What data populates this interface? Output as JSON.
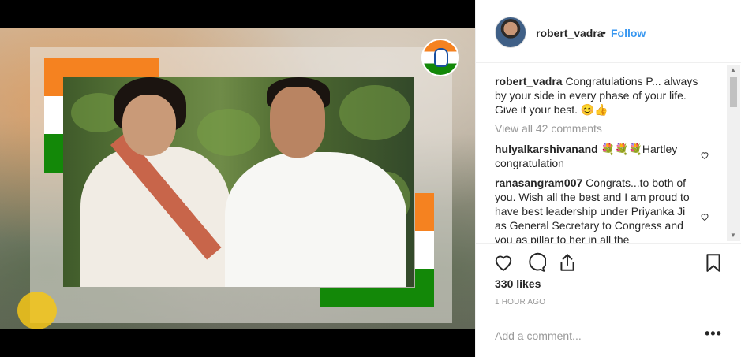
{
  "post": {
    "username": "robert_vadra",
    "separator": "•",
    "follow_label": "Follow",
    "caption_user": "robert_vadra",
    "caption_text": " Congratulations P... always by your side in every phase of your life. Give it your best. 😊👍",
    "view_all_comments": "View all 42 comments",
    "comments": [
      {
        "user": "hulyalkarshivanand",
        "text": " 💐💐💐Hartley congratulation"
      },
      {
        "user": "ranasangram007",
        "text": " Congrats...to both of you. Wish all the best and I am proud to have best leadership under Priyanka Ji as General Secretary to Congress and you as pillar to her in all the"
      }
    ],
    "likes": "330 likes",
    "time": "1 HOUR AGO",
    "add_comment_placeholder": "Add a comment...",
    "more_label": "•••"
  },
  "icons": {
    "like": "heart-icon",
    "comment": "comment-icon",
    "share": "share-icon",
    "save": "bookmark-icon",
    "comment_like": "heart-icon",
    "options": "more-options-icon"
  },
  "colors": {
    "follow": "#3897f0",
    "saffron": "#f58220",
    "green": "#138808",
    "text": "#262626",
    "muted": "#999999"
  }
}
